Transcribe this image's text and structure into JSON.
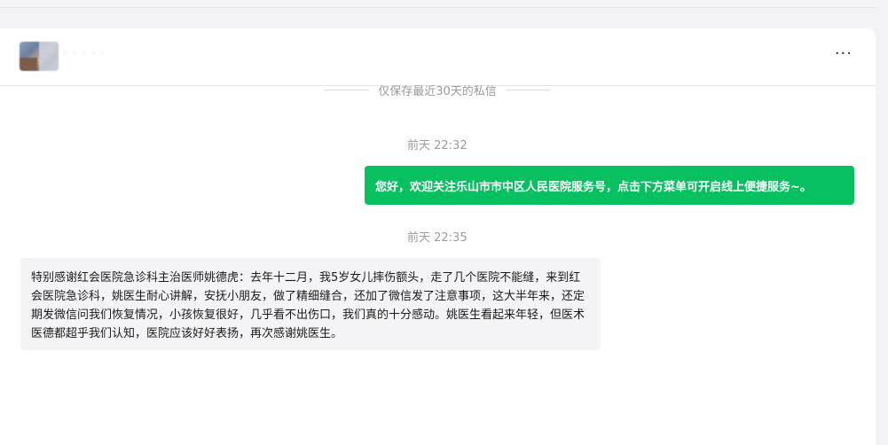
{
  "header": {
    "contact_name": "· · ·  · ·",
    "more_label": "···"
  },
  "notice": {
    "text": "仅保存最近30天的私信"
  },
  "messages": [
    {
      "time": "前天 22:32",
      "side": "right",
      "text": "您好，欢迎关注乐山市市中区人民医院服务号，点击下方菜单可开启线上便捷服务~。"
    },
    {
      "time": "前天 22:35",
      "side": "left",
      "text": "特别感谢红会医院急诊科主治医师姚德虎：去年十二月，我5岁女儿摔伤额头，走了几个医院不能缝，来到红会医院急诊科，姚医生耐心讲解，安抚小朋友，做了精细缝合，还加了微信发了注意事项，这大半年来，还定期发微信问我们恢复情况，小孩恢复很好，几乎看不出伤口，我们真的十分感动。姚医生看起来年轻，但医术医德都超乎我们认知，医院应该好好表扬，再次感谢姚医生。"
    }
  ],
  "colors": {
    "accent_green": "#07c160",
    "page_bg": "#f3f3f5",
    "incoming_bubble": "#f4f4f6"
  },
  "icons": {
    "more": "more-horizontal-icon",
    "avatar": "contact-avatar"
  }
}
